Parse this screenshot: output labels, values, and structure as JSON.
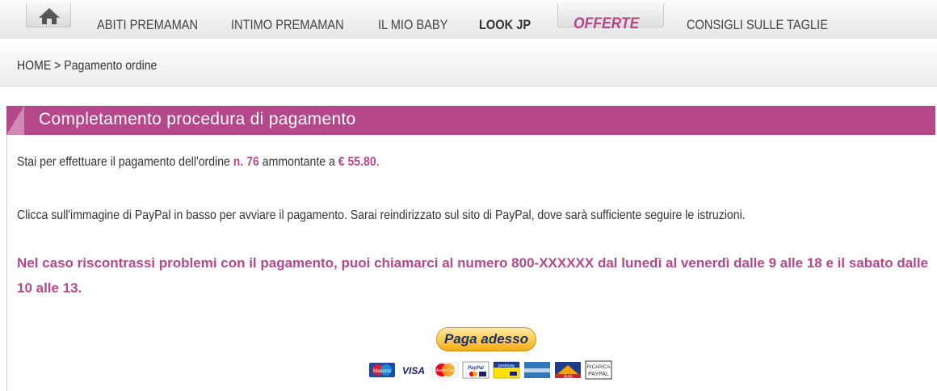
{
  "nav": {
    "items": [
      {
        "label": "ABITI PREMAMAN"
      },
      {
        "label": "INTIMO PREMAMAN"
      },
      {
        "label": "IL MIO BABY"
      },
      {
        "label": "LOOK JP"
      },
      {
        "label": "OFFERTE"
      },
      {
        "label": "CONSIGLI SULLE TAGLIE"
      }
    ],
    "home_icon": "home-icon"
  },
  "breadcrumb": {
    "home": "HOME",
    "separator": ">",
    "current": "Pagamento ordine"
  },
  "panel": {
    "title": "Completamento procedura di pagamento",
    "line1_prefix": "Stai per effettuare il pagamento dell'ordine",
    "order_number": "n. 76",
    "line1_middle": "ammontante a",
    "amount": "€ 55.80",
    "line1_suffix": ".",
    "line2": "Clicca sull'immagine di PayPal in basso per avviare il pagamento. Sarai reindirizzato sul sito di PayPal, dove sarà sufficiente seguire le istruzioni.",
    "notice": "Nel caso riscontrassi problemi con il pagamento, puoi chiamarci al numero 800-XXXXXX dal lunedì al venerdì dalle 9 alle 18 e il sabato dalle 10 alle 13."
  },
  "payment": {
    "button_label": "Paga adesso",
    "cards": [
      {
        "name": "Maestro",
        "label": "Maestro"
      },
      {
        "name": "Visa",
        "label": "VISA"
      },
      {
        "name": "MasterCard",
        "label": "MasterCard"
      },
      {
        "name": "PayPal",
        "label": "PayPal"
      },
      {
        "name": "Postepay",
        "label": "postepay"
      },
      {
        "name": "American Express",
        "label": ""
      },
      {
        "name": "Aura",
        "label": "Aura"
      },
      {
        "name": "Ricarica PayPal",
        "label1": "RICARICA",
        "label2": "PAYPAL"
      }
    ]
  },
  "colors": {
    "accent": "#b7478b",
    "title_bar": "#b7478b",
    "button_gold": "#ffc439"
  }
}
